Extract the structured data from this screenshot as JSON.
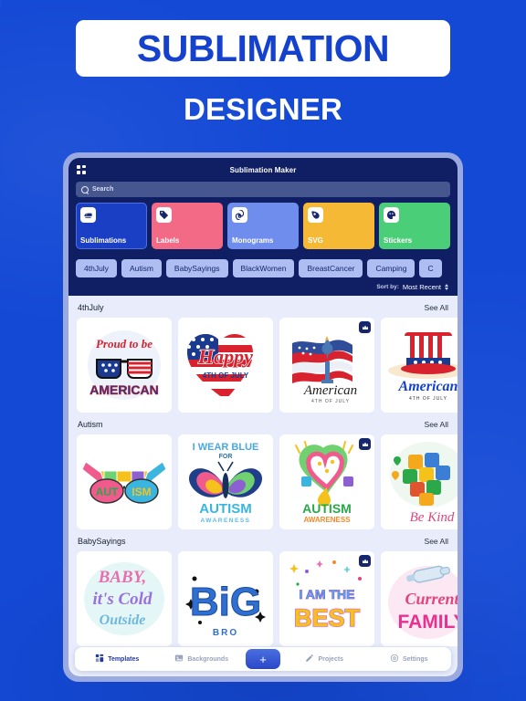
{
  "promo": {
    "title": "SUBLIMATION",
    "subtitle": "DESIGNER"
  },
  "colors": {
    "backdrop": "#1449d6",
    "app_header": "#101f63",
    "content_bg": "#e8ecfb",
    "chip_bg": "#aebdf2",
    "accent": "#2b47c9",
    "frame": "#9aa9e0"
  },
  "app": {
    "title": "Sublimation Maker",
    "menu_icon": "grid-icon",
    "search": {
      "icon": "search-icon",
      "placeholder": "Search",
      "value": ""
    },
    "categories": [
      {
        "label": "Sublimations",
        "icon": "iron-icon",
        "color": "#1a3fc4",
        "selected": true
      },
      {
        "label": "Labels",
        "icon": "tag-icon",
        "color": "#f36a87",
        "selected": false
      },
      {
        "label": "Monograms",
        "icon": "spiral-icon",
        "color": "#6f8ded",
        "selected": false
      },
      {
        "label": "SVG",
        "icon": "pen-nib-icon",
        "color": "#f5b936",
        "selected": false
      },
      {
        "label": "Stickers",
        "icon": "sticker-icon",
        "color": "#4bce78",
        "selected": false
      }
    ],
    "chips": [
      "4thJuly",
      "Autism",
      "BabySayings",
      "BlackWomen",
      "BreastCancer",
      "Camping",
      "C"
    ],
    "sort": {
      "label": "Sort by:",
      "value": "Most Recent",
      "icon": "up-down-chevron-icon"
    },
    "sections": [
      {
        "title": "4thJuly",
        "see_all": "See All",
        "cards": [
          {
            "name": "proud-to-be-american",
            "premium": false
          },
          {
            "name": "happy-4th-of-july-heart",
            "premium": false
          },
          {
            "name": "american-statue-flag",
            "premium": true
          },
          {
            "name": "american-uncle-sam-hat",
            "premium": true
          }
        ]
      },
      {
        "title": "Autism",
        "see_all": "See All",
        "cards": [
          {
            "name": "autism-sunglasses-bandana",
            "premium": false
          },
          {
            "name": "i-wear-blue-butterfly",
            "premium": false
          },
          {
            "name": "autism-awareness-heart",
            "premium": true
          },
          {
            "name": "be-kind-puzzle-heart",
            "premium": true
          }
        ]
      },
      {
        "title": "BabySayings",
        "see_all": "See All",
        "cards": [
          {
            "name": "baby-its-cold",
            "premium": false
          },
          {
            "name": "big",
            "premium": false
          },
          {
            "name": "i-am-the-best",
            "premium": true
          },
          {
            "name": "current-family",
            "premium": true
          }
        ]
      }
    ],
    "nav": [
      {
        "label": "Templates",
        "icon": "templates-icon",
        "active": true
      },
      {
        "label": "Backgrounds",
        "icon": "image-icon",
        "active": false
      },
      {
        "label": "Projects",
        "icon": "pencil-icon",
        "active": false
      },
      {
        "label": "Settings",
        "icon": "gear-icon",
        "active": false
      }
    ],
    "fab": {
      "label": "+",
      "icon": "plus-icon"
    }
  }
}
